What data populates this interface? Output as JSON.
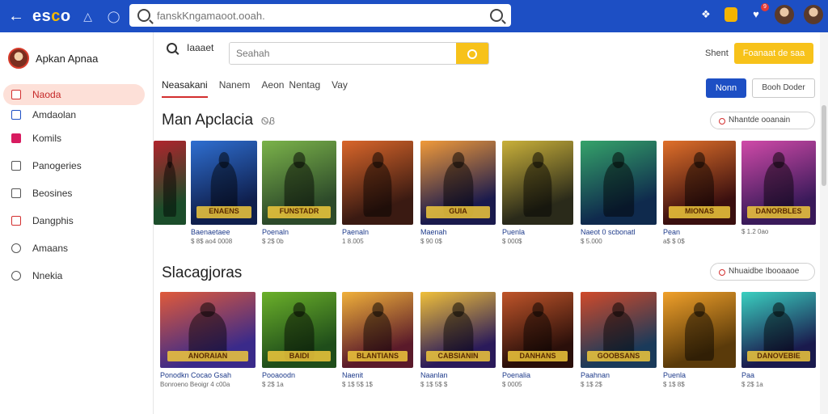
{
  "topbar": {
    "logo": "esco",
    "search_placeholder": "fanskKngamaoot.ooah.",
    "icons": [
      "back-arrow-icon",
      "bell-icon",
      "shield-icon",
      "search-icon",
      "puzzle-icon",
      "bookmark-icon",
      "notifications-icon",
      "avatar"
    ],
    "notification_count": "9"
  },
  "sidebar": {
    "user_name": "Apkan Apnaa",
    "items": [
      {
        "label": "Naoda",
        "icon": "home-icon"
      },
      {
        "label": "Amdaolan",
        "icon": "apps-icon"
      },
      {
        "label": "Komils",
        "icon": "games-icon"
      },
      {
        "label": "Panogeries",
        "icon": "categories-icon"
      },
      {
        "label": "Beosines",
        "icon": "edit-icon"
      },
      {
        "label": "Dangphis",
        "icon": "chart-icon"
      },
      {
        "label": "Amaans",
        "icon": "link-icon"
      },
      {
        "label": "Nnekia",
        "icon": "clock-icon"
      }
    ]
  },
  "main": {
    "search_label": "Iaaaet",
    "search_placeholder": "Seahah",
    "sort_label": "Shent",
    "cta_label": "Foanaat de saa",
    "tabs": [
      "Neasakani",
      "Nanem",
      "Aeon",
      "Nentag",
      "Vay"
    ],
    "btn_primary": "Nonn",
    "btn_secondary": "Booh Doder",
    "section1": {
      "title": "Man Apclacia",
      "hint": "ᏫᏰ",
      "filter": "Nhantde ooanain",
      "cards": [
        {
          "name": "",
          "meta": "",
          "art": [
            "#1b4d2a",
            "#b0242c"
          ],
          "logo": ""
        },
        {
          "name": "Baenaetaee",
          "meta": "$ 8$ ao4 0008",
          "art": [
            "#0f1f4d",
            "#2f6fd1"
          ],
          "logo": "ENAENS"
        },
        {
          "name": "Poenaln",
          "meta": "$ 2$ 0b",
          "art": [
            "#2d4a2a",
            "#7bb34a"
          ],
          "logo": "FUNSTADR"
        },
        {
          "name": "Paenaln",
          "meta": "1 8.005",
          "art": [
            "#3a1a12",
            "#d9662a"
          ],
          "logo": ""
        },
        {
          "name": "Maenah",
          "meta": "$ 90 0$",
          "art": [
            "#1a1a4d",
            "#f09a3a"
          ],
          "logo": "GUIA"
        },
        {
          "name": "Puenla",
          "meta": "$ 000$",
          "art": [
            "#2a2a1a",
            "#c9b03a"
          ],
          "logo": ""
        },
        {
          "name": "Naeot 0 scbonatl",
          "meta": "$ 5.000",
          "art": [
            "#0f2a4d",
            "#35a36a"
          ],
          "logo": ""
        },
        {
          "name": "Pean",
          "meta": "a$ $ 0$",
          "art": [
            "#3a0f0f",
            "#e0702a"
          ],
          "logo": "MIONAS"
        },
        {
          "name": "",
          "meta": "$ 1.2 0ao",
          "art": [
            "#3a1a5a",
            "#d04aa8"
          ],
          "logo": "DANORBLES"
        }
      ]
    },
    "section2": {
      "title": "Slacagjoras",
      "filter": "Nhuaidbe Ibooaaoe",
      "cards": [
        {
          "name": "Ponodkn Cocao Gsah",
          "meta": "Bonroeno Beoigr 4 c00a",
          "art": [
            "#3a2a8a",
            "#e05a3a"
          ],
          "logo": "ANORAIAN"
        },
        {
          "name": "Pooaoodn",
          "meta": "$ 2$ 1a",
          "art": [
            "#1f4d1a",
            "#6bb02a"
          ],
          "logo": "BAIDI"
        },
        {
          "name": "Naenit",
          "meta": "$ 1$ 5$ 1$",
          "art": [
            "#5a1a2a",
            "#f0b03a"
          ],
          "logo": "BLANTIANS"
        },
        {
          "name": "Naanlan",
          "meta": "$ 1$ 5$ $",
          "art": [
            "#2a1a5a",
            "#f0c03a"
          ],
          "logo": "CABSIANIN"
        },
        {
          "name": "Poenalia",
          "meta": "$ 0005",
          "art": [
            "#2a0f0a",
            "#c0552a"
          ],
          "logo": "DANHANS"
        },
        {
          "name": "Paahnan",
          "meta": "$ 1$ 2$",
          "art": [
            "#1a3a5a",
            "#d04a2a"
          ],
          "logo": "GOOBSANS"
        },
        {
          "name": "Puenla",
          "meta": "$ 1$ 8$",
          "art": [
            "#5a3a0a",
            "#f0a02a"
          ],
          "logo": ""
        },
        {
          "name": "Paa",
          "meta": "$ 2$ 1a",
          "art": [
            "#1a1a4d",
            "#3ad0c0"
          ],
          "logo": "DANOVEBIE"
        }
      ]
    }
  }
}
